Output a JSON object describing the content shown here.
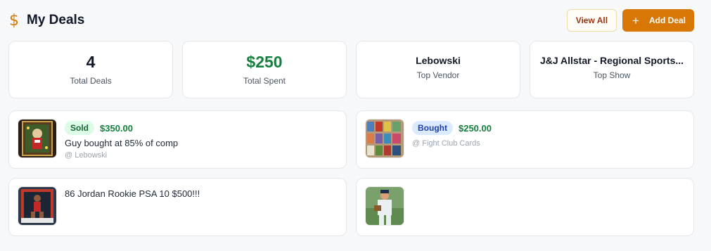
{
  "header": {
    "title": "My Deals",
    "view_all_label": "View All",
    "add_deal_label": "Add Deal",
    "accent_color": "#d97706"
  },
  "stats": [
    {
      "value": "4",
      "label": "Total Deals"
    },
    {
      "value": "$250",
      "label": "Total Spent"
    },
    {
      "value": "Lebowski",
      "label": "Top Vendor"
    },
    {
      "value": "J&J Allstar - Regional Sports...",
      "label": "Top Show"
    }
  ],
  "deals": [
    {
      "badge": "Sold",
      "price": "$350.00",
      "text": "Guy bought at 85% of comp",
      "vendor": "@ Lebowski",
      "image": "card-thumbnail"
    },
    {
      "badge": "Bought",
      "price": "$250.00",
      "text": "",
      "vendor": "@ Fight Club Cards",
      "image": "cards-collection-thumbnail"
    },
    {
      "badge": "",
      "price": "",
      "text": "86 Jordan Rookie PSA 10 $500!!!",
      "vendor": "",
      "image": "jordan-card-thumbnail"
    },
    {
      "badge": "",
      "price": "",
      "text": "",
      "vendor": "",
      "image": "baseball-player-thumbnail"
    }
  ]
}
